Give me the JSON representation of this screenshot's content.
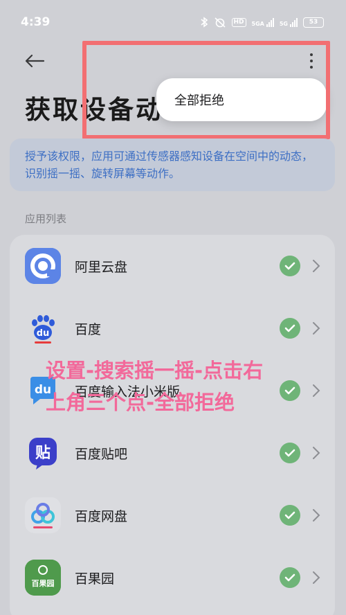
{
  "status_bar": {
    "time": "4:39",
    "hd": "HD",
    "net1": "5GA",
    "net2": "5G",
    "battery": "53"
  },
  "header": {
    "title": "获取设备动"
  },
  "menu": {
    "items": [
      {
        "label": "全部拒绝"
      }
    ]
  },
  "description": "授予该权限，应用可通过传感器感知设备在空间中的动态，识别摇一摇、旋转屏幕等动作。",
  "section_label": "应用列表",
  "apps": [
    {
      "name": "阿里云盘"
    },
    {
      "name": "百度"
    },
    {
      "name": "百度输入法小米版"
    },
    {
      "name": "百度贴吧"
    },
    {
      "name": "百度网盘"
    },
    {
      "name": "百果园"
    }
  ],
  "icon_text": {
    "baidu": "du",
    "baidu_ime": "du",
    "tieba": "贴",
    "baiguoyuan": "百果园"
  },
  "overlay": {
    "line1": "设置-搜索摇一摇-点击右",
    "line2": "上角三个点-全部拒绝"
  },
  "colors": {
    "accent_blue": "#3d6fc4",
    "check_green": "#6fb478",
    "highlight_red": "#f26f72",
    "overlay_pink": "#f2699a"
  }
}
